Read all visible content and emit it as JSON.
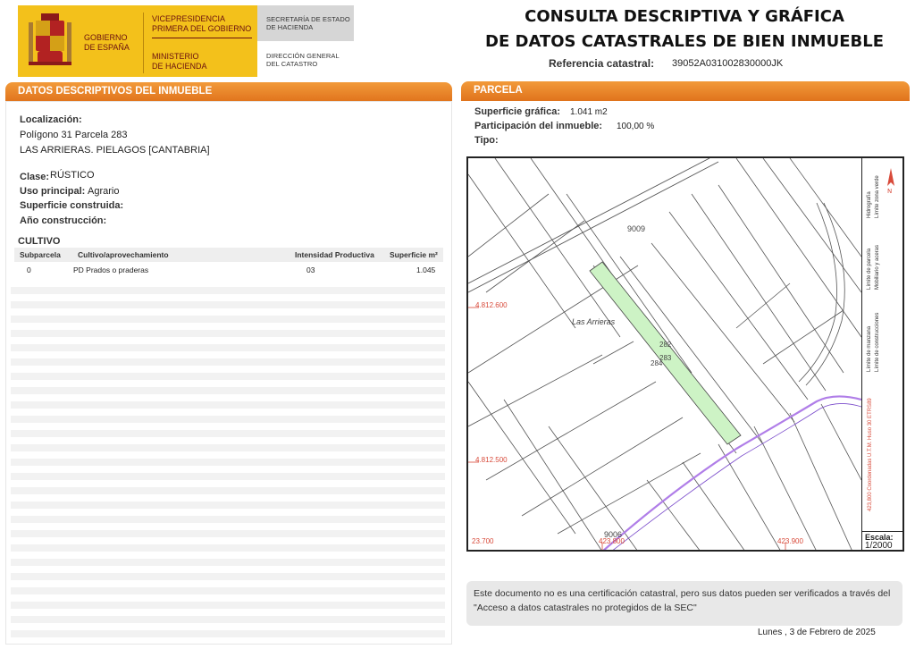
{
  "logo": {
    "gobierno": "GOBIERNO\nDE ESPAÑA",
    "vicepresidencia": "VICEPRESIDENCIA\nPRIMERA DEL GOBIERNO",
    "ministerio": "MINISTERIO\nDE HACIENDA",
    "secretaria": "SECRETARÍA DE ESTADO\nDE HACIENDA",
    "direccion": "DIRECCIÓN GENERAL\nDEL CATASTRO"
  },
  "header": {
    "title_line1": "CONSULTA DESCRIPTIVA Y GRÁFICA",
    "title_line2": "DE DATOS CATASTRALES DE BIEN INMUEBLE",
    "ref_label": "Referencia catastral:",
    "ref_value": "39052A031002830000JK"
  },
  "left": {
    "section_title": "DATOS DESCRIPTIVOS DEL INMUEBLE",
    "localizacion_label": "Localización:",
    "localizacion_line1": "Polígono 31 Parcela 283",
    "localizacion_line2": "LAS ARRIERAS. PIELAGOS [CANTABRIA]",
    "clase_label": "Clase:",
    "clase_value": "RÚSTICO",
    "uso_label": "Uso principal:",
    "uso_value": "Agrario",
    "superficie_label": "Superficie construida:",
    "anio_label": "Año construcción:",
    "cultivo_title": "CULTIVO",
    "table": {
      "headers": [
        "Subparcela",
        "Cultivo/aprovechamiento",
        "Intensidad Productiva",
        "Superficie m²"
      ],
      "rows": [
        {
          "subparcela": "0",
          "cultivo": "PD Prados o praderas",
          "intensidad": "03",
          "superficie": "1.045"
        }
      ]
    }
  },
  "right": {
    "section_title": "PARCELA",
    "sup_grafica_label": "Superficie gráfica:",
    "sup_grafica_value": "1.041 m2",
    "participacion_label": "Participación del inmueble:",
    "participacion_value": "100,00 %",
    "tipo_label": "Tipo:",
    "map": {
      "labels": {
        "road_top": "9009",
        "road_bottom": "9006",
        "place": "Las Arrieras",
        "parcel_a": "282",
        "parcel_b": "283",
        "parcel_c": "284",
        "y1": "4.812.600",
        "y2": "4.812.500",
        "x0": "23.700",
        "x1": "423.800",
        "x2": "423.900"
      },
      "legend": {
        "hidrografia": "Hidrografía",
        "limite_zona_verde": "Límite zona verde",
        "limite_parcela": "Límite de parcela",
        "mobiliario": "Mobiliario y aceras",
        "limite_manzana": "Límite de manzana",
        "limite_construcciones": "Límite de construcciones",
        "coordenadas": "423,800 Coordenadas U.T.M. Huso 30 ETRS89"
      },
      "scale_label": "Escala:",
      "scale_value": "1/2000",
      "colors": {
        "parcel_fill": "#cdf3c5",
        "road": "#b07ee8",
        "lines": "#555555",
        "coords": "#d84a3a"
      }
    },
    "note": "Este documento no es una certificación catastral, pero sus datos pueden ser verificados a través del \"Acceso a datos catastrales no protegidos de la SEC\"",
    "date": "Lunes , 3 de Febrero de 2025"
  }
}
